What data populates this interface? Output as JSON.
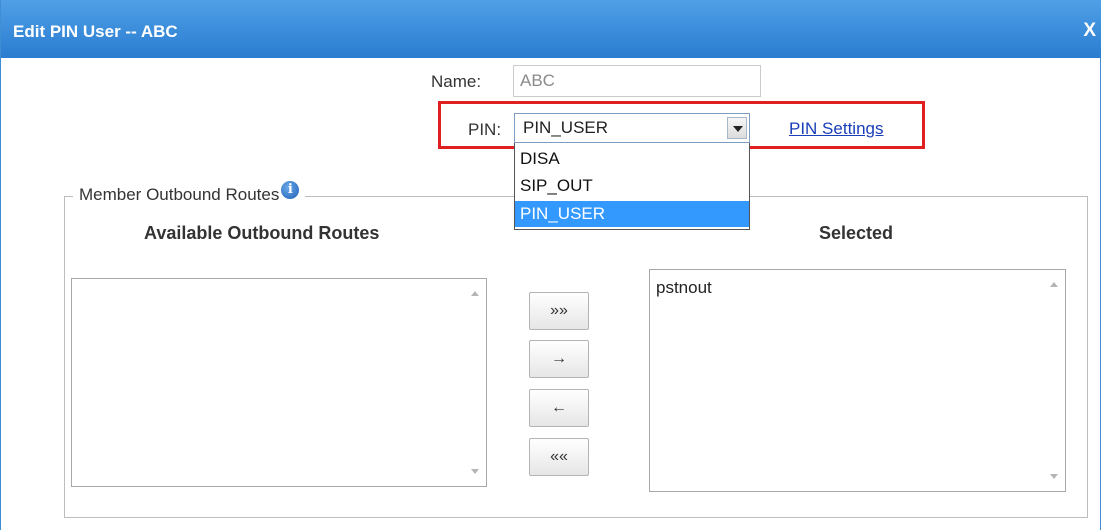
{
  "dialog": {
    "title": "Edit PIN User -- ABC",
    "close_label": "X"
  },
  "form": {
    "name_label": "Name:",
    "name_value": "ABC",
    "pin_label": "PIN:",
    "pin_selected": "PIN_USER",
    "pin_settings_link": "PIN Settings",
    "pin_options": [
      "DISA",
      "SIP_OUT",
      "PIN_USER"
    ]
  },
  "routes": {
    "legend": "Member Outbound Routes",
    "available_heading": "Available Outbound Routes",
    "selected_heading": "Selected",
    "available_items": [],
    "selected_items": [
      "pstnout"
    ]
  },
  "buttons": {
    "add_all": "»»",
    "add_one": "→",
    "remove_one": "←",
    "remove_all": "««"
  },
  "colors": {
    "titlebar": "#3a8ddc",
    "highlight": "#e02020",
    "link": "#1a3eb8",
    "selected_option": "#3399ff"
  }
}
